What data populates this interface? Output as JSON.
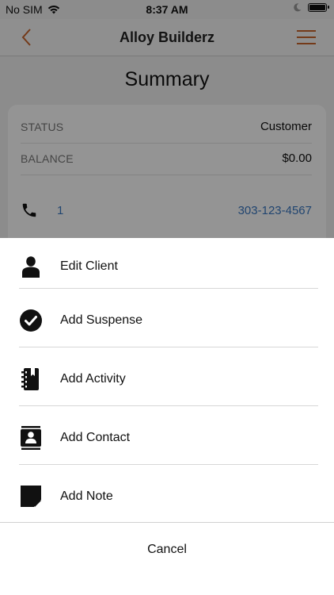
{
  "status_bar": {
    "carrier": "No SIM",
    "time": "8:37 AM"
  },
  "nav": {
    "title": "Alloy Builderz",
    "accent_color": "#c8642c"
  },
  "summary": {
    "title": "Summary",
    "status_label": "STATUS",
    "status_value": "Customer",
    "balance_label": "BALANCE",
    "balance_value": "$0.00",
    "phone_index": "1",
    "phone_number": "303-123-4567",
    "link_color": "#3a78c2"
  },
  "action_sheet": {
    "items": [
      {
        "label": "Edit Client",
        "icon": "person-icon"
      },
      {
        "label": "Add Suspense",
        "icon": "check-circle-icon"
      },
      {
        "label": "Add Activity",
        "icon": "notebook-icon"
      },
      {
        "label": "Add Contact",
        "icon": "contact-card-icon"
      },
      {
        "label": "Add Note",
        "icon": "note-icon"
      }
    ],
    "cancel_label": "Cancel"
  }
}
